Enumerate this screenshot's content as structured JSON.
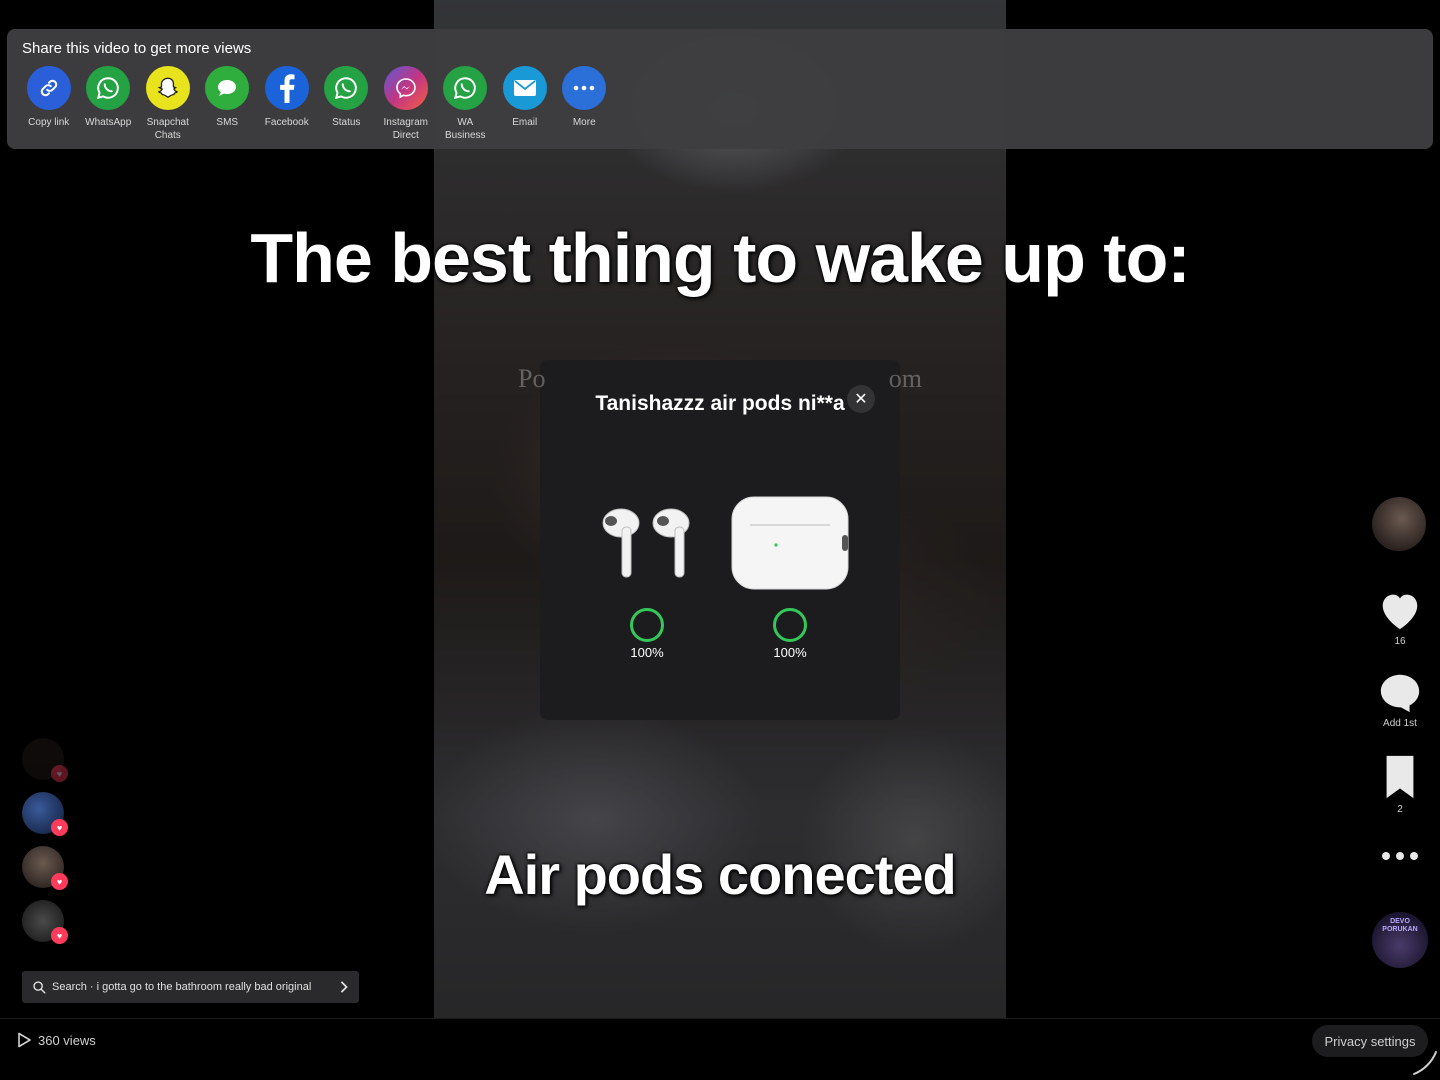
{
  "share": {
    "title": "Share this video to get more views",
    "items": [
      {
        "label": "Copy link",
        "icon": "link-icon",
        "color": "#2b5fd9"
      },
      {
        "label": "WhatsApp",
        "icon": "whatsapp-icon",
        "color": "#25a244"
      },
      {
        "label": "Snapchat Chats",
        "icon": "snapchat-icon",
        "color": "#e8e31d"
      },
      {
        "label": "SMS",
        "icon": "sms-icon",
        "color": "#2fae3e"
      },
      {
        "label": "Facebook",
        "icon": "facebook-icon",
        "color": "#1b63d8"
      },
      {
        "label": "Status",
        "icon": "whatsapp-status-icon",
        "color": "#25a244"
      },
      {
        "label": "Instagram Direct",
        "icon": "messenger-icon",
        "color": "#a83fb0"
      },
      {
        "label": "WA Business",
        "icon": "wa-business-icon",
        "color": "#25a244"
      },
      {
        "label": "Email",
        "icon": "email-icon",
        "color": "#199ad6"
      },
      {
        "label": "More",
        "icon": "more-dots-icon",
        "color": "#2b6fd9"
      }
    ]
  },
  "video": {
    "caption_top": "The best thing to wake up to:",
    "caption_bottom": "Air pods conected",
    "ghost_left": "Po",
    "ghost_right": "om"
  },
  "popup": {
    "title": "Tanishazzz air pods ni**a",
    "close": "✕",
    "left_battery": "100%",
    "right_battery": "100%",
    "battery_color": "#34c759"
  },
  "rail": {
    "like_count": "16",
    "comment_label": "Add 1st",
    "bookmark_count": "2",
    "music_label": "DEVO PORUKAN"
  },
  "search": {
    "text": "Search · i gotta go to the bathroom really bad original"
  },
  "footer": {
    "views": "360 views",
    "privacy": "Privacy settings"
  }
}
